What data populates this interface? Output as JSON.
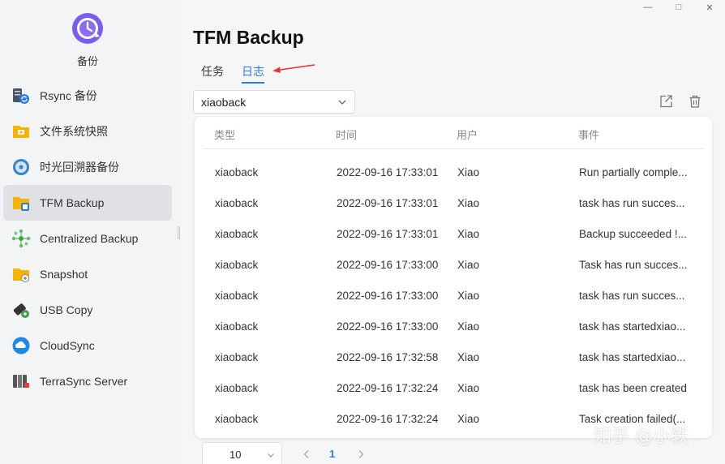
{
  "window": {
    "minimize_glyph": "—",
    "maximize_glyph": "□",
    "close_glyph": "✕"
  },
  "app": {
    "name": "备份",
    "icon": "backup-clock-icon"
  },
  "sidebar": {
    "items": [
      {
        "label": "Rsync 备份",
        "icon": "rsync-server-icon"
      },
      {
        "label": "文件系统快照",
        "icon": "folder-snapshot-icon"
      },
      {
        "label": "时光回溯器备份",
        "icon": "time-machine-icon"
      },
      {
        "label": "TFM Backup",
        "icon": "tfm-backup-folder-icon",
        "active": true
      },
      {
        "label": "Centralized Backup",
        "icon": "centralized-network-icon"
      },
      {
        "label": "Snapshot",
        "icon": "snapshot-folder-icon"
      },
      {
        "label": "USB Copy",
        "icon": "usb-drive-icon"
      },
      {
        "label": "CloudSync",
        "icon": "cloud-sync-icon"
      },
      {
        "label": "TerraSync Server",
        "icon": "terrasync-server-icon"
      }
    ]
  },
  "main": {
    "title": "TFM Backup",
    "tabs": [
      {
        "label": "任务",
        "active": false
      },
      {
        "label": "日志",
        "active": true
      }
    ],
    "task_select": {
      "value": "xiaoback"
    },
    "toolbar": {
      "export_icon": "export-icon",
      "delete_icon": "trash-icon"
    },
    "table": {
      "columns": [
        "类型",
        "时间",
        "用户",
        "事件"
      ],
      "rows": [
        {
          "type": "xiaoback",
          "time": "2022-09-16 17:33:01",
          "user": "Xiao",
          "event": "Run partially comple..."
        },
        {
          "type": "xiaoback",
          "time": "2022-09-16 17:33:01",
          "user": "Xiao",
          "event": "task has run succes..."
        },
        {
          "type": "xiaoback",
          "time": "2022-09-16 17:33:01",
          "user": "Xiao",
          "event": "Backup succeeded !..."
        },
        {
          "type": "xiaoback",
          "time": "2022-09-16 17:33:00",
          "user": "Xiao",
          "event": "Task has run succes..."
        },
        {
          "type": "xiaoback",
          "time": "2022-09-16 17:33:00",
          "user": "Xiao",
          "event": "task has run succes..."
        },
        {
          "type": "xiaoback",
          "time": "2022-09-16 17:33:00",
          "user": "Xiao",
          "event": "task has startedxiao..."
        },
        {
          "type": "xiaoback",
          "time": "2022-09-16 17:32:58",
          "user": "Xiao",
          "event": "task has startedxiao..."
        },
        {
          "type": "xiaoback",
          "time": "2022-09-16 17:32:24",
          "user": "Xiao",
          "event": "task has been created"
        },
        {
          "type": "xiaoback",
          "time": "2022-09-16 17:32:24",
          "user": "Xiao",
          "event": "Task creation failed(..."
        }
      ]
    },
    "pagination": {
      "page_size": "10",
      "current_page": "1"
    }
  },
  "watermark": "知乎 @小轶",
  "colors": {
    "accent": "#2d7be5",
    "annotation_arrow": "#e53935",
    "sidebar_active": "#dfe1e5"
  }
}
